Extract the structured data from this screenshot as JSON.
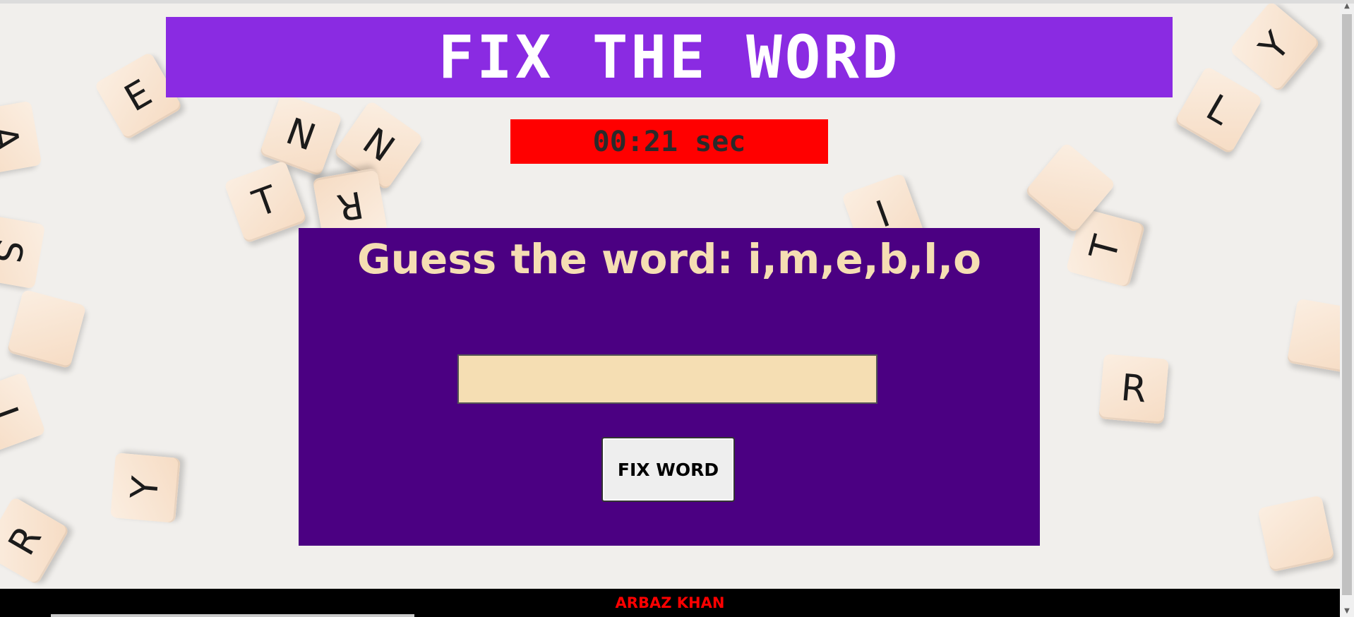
{
  "page": {
    "title": "FIX THE WORD",
    "timer": "00:21 sec",
    "prompt": "Guess the word: i,m,e,b,l,o",
    "input_value": "",
    "button_label": "FIX WORD",
    "footer": "ARBAZ KHAN"
  },
  "background_tiles": [
    "E",
    "N",
    "N",
    "T",
    "R",
    "A",
    "S",
    "I",
    "Y",
    "R",
    "Y",
    "L",
    "T",
    "R",
    "I"
  ],
  "colors": {
    "title_bg": "#8a2be2",
    "timer_bg": "#ff0000",
    "panel_bg": "#4b0082",
    "prompt_text": "#f5deb3",
    "input_bg": "#f5deb3",
    "footer_bg": "#000000",
    "footer_text": "#ff0000"
  },
  "icons": {
    "scroll_up": "triangle-up-icon",
    "scroll_down": "triangle-down-icon"
  }
}
